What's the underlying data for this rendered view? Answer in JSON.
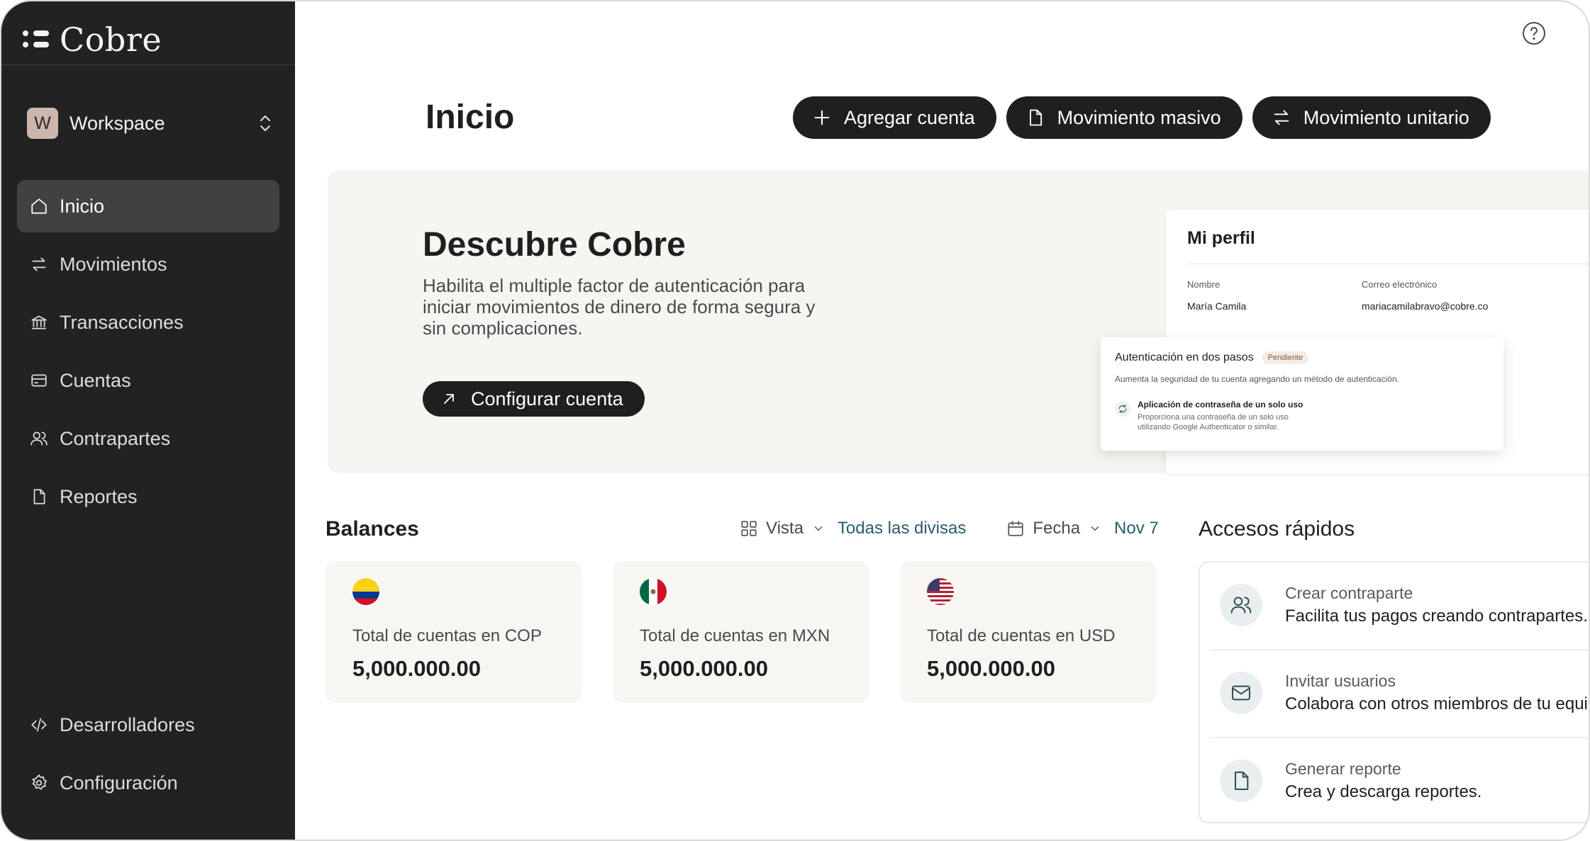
{
  "brand": {
    "name": "Cobre"
  },
  "workspace": {
    "initial": "W",
    "name": "Workspace"
  },
  "sidebar": {
    "items": [
      {
        "label": "Inicio",
        "icon": "home-icon",
        "active": true
      },
      {
        "label": "Movimientos",
        "icon": "arrows-swap-icon"
      },
      {
        "label": "Transacciones",
        "icon": "bank-icon"
      },
      {
        "label": "Cuentas",
        "icon": "card-icon"
      },
      {
        "label": "Contrapartes",
        "icon": "users-icon"
      },
      {
        "label": "Reportes",
        "icon": "document-icon"
      }
    ],
    "bottom": [
      {
        "label": "Desarrolladores",
        "icon": "code-icon"
      },
      {
        "label": "Configuración",
        "icon": "gear-icon"
      }
    ]
  },
  "header": {
    "title": "Inicio",
    "actions": {
      "add_account": "Agregar cuenta",
      "bulk_movement": "Movimiento masivo",
      "single_movement": "Movimiento unitario"
    }
  },
  "banner": {
    "title": "Descubre Cobre",
    "text": "Habilita el multiple factor de autenticación para iniciar movimientos de dinero de forma segura y sin complicaciones.",
    "button": "Configurar cuenta",
    "profile": {
      "title": "Mi perfil",
      "name_label": "Nombre",
      "name_value": "María Camila",
      "email_label": "Correo electrónico",
      "email_value": "mariacamilabravo@cobre.co"
    },
    "auth": {
      "title": "Autenticación en dos pasos",
      "badge": "Pendiente",
      "description": "Aumenta la seguridad de tu cuenta agregando un método de autenticación.",
      "option_title": "Aplicación de contraseña de un solo uso",
      "option_desc": "Proporciona una contraseña de un solo uso utilizando Google Authenticator o similar."
    }
  },
  "balances": {
    "title": "Balances",
    "view_label": "Vista",
    "view_value": "Todas las divisas",
    "date_label": "Fecha",
    "date_value": "Nov 7",
    "cards": [
      {
        "label": "Total de cuentas en COP",
        "value": "5,000.000.00",
        "flag": "colombia-flag-icon"
      },
      {
        "label": "Total de cuentas en MXN",
        "value": "5,000.000.00",
        "flag": "mexico-flag-icon"
      },
      {
        "label": "Total de cuentas en USD",
        "value": "5,000.000.00",
        "flag": "usa-flag-icon"
      }
    ]
  },
  "quick_access": {
    "title": "Accesos rápidos",
    "items": [
      {
        "title": "Crear contraparte",
        "desc": "Facilita tus pagos creando contrapartes.",
        "icon": "users-icon"
      },
      {
        "title": "Invitar usuarios",
        "desc": "Colabora con otros miembros de tu equipo.",
        "icon": "mail-icon"
      },
      {
        "title": "Generar reporte",
        "desc": "Crea y descarga reportes.",
        "icon": "document-icon"
      }
    ]
  },
  "colors": {
    "sidebar_bg": "#222222",
    "accent_link": "#2c5d6b",
    "banner_bg": "#f6f5f1"
  }
}
